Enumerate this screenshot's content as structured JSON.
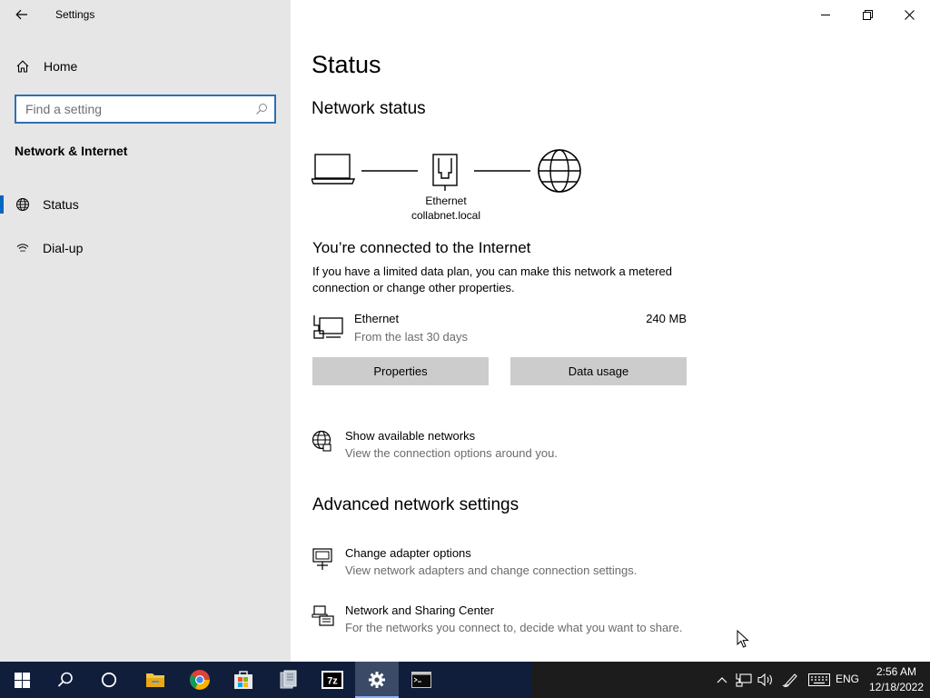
{
  "window": {
    "title": "Settings"
  },
  "sidebar": {
    "home_label": "Home",
    "search_placeholder": "Find a setting",
    "section_title": "Network & Internet",
    "items": [
      {
        "label": "Status",
        "icon": "status-icon",
        "active": true
      },
      {
        "label": "Dial-up",
        "icon": "dialup-icon",
        "active": false
      }
    ]
  },
  "main": {
    "title": "Status",
    "network_status_heading": "Network status",
    "diagram": {
      "adapter_name": "Ethernet",
      "domain": "collabnet.local"
    },
    "connected_heading": "You’re connected to the Internet",
    "connected_desc": "If you have a limited data plan, you can make this network a metered connection or change other properties.",
    "connection": {
      "name": "Ethernet",
      "subtitle": "From the last 30 days",
      "usage": "240 MB"
    },
    "buttons": {
      "properties": "Properties",
      "data_usage": "Data usage"
    },
    "show_networks": {
      "title": "Show available networks",
      "desc": "View the connection options around you."
    },
    "advanced_heading": "Advanced network settings",
    "adapter_options": {
      "title": "Change adapter options",
      "desc": "View network adapters and change connection settings."
    },
    "sharing_center": {
      "title": "Network and Sharing Center",
      "desc": "For the networks you connect to, decide what you want to share."
    }
  },
  "taskbar": {
    "language": "ENG",
    "time": "2:56 AM",
    "date": "12/18/2022",
    "apps": [
      "start",
      "search",
      "cortana",
      "file-explorer",
      "chrome",
      "store",
      "archive",
      "7zip",
      "settings",
      "terminal"
    ]
  },
  "colors": {
    "accent": "#0067c0",
    "sidebar_bg": "#e6e6e6",
    "taskbar_bg": "#101e3c",
    "button_bg": "#cccccc",
    "search_border": "#2e6fb5"
  }
}
